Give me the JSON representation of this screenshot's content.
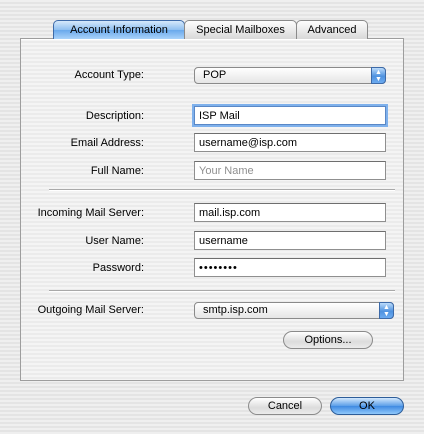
{
  "tabs": [
    {
      "label": "Account Information",
      "active": true
    },
    {
      "label": "Special Mailboxes",
      "active": false
    },
    {
      "label": "Advanced",
      "active": false
    }
  ],
  "form": {
    "account_type": {
      "label": "Account Type:",
      "value": "POP"
    },
    "description": {
      "label": "Description:",
      "value": "ISP Mail"
    },
    "email": {
      "label": "Email Address:",
      "value": "username@isp.com"
    },
    "full_name": {
      "label": "Full Name:",
      "value": "",
      "placeholder": "Your Name"
    },
    "incoming": {
      "label": "Incoming Mail Server:",
      "value": "mail.isp.com"
    },
    "user_name": {
      "label": "User Name:",
      "value": "username"
    },
    "password": {
      "label": "Password:",
      "value": "passwor9"
    },
    "outgoing": {
      "label": "Outgoing Mail Server:",
      "value": "smtp.isp.com"
    },
    "options_label": "Options..."
  },
  "buttons": {
    "cancel": "Cancel",
    "ok": "OK"
  },
  "colors": {
    "accent": "#6aa9ec",
    "default_button": "#3f8ae2"
  },
  "icons": {
    "popup_arrows": "up-down-arrows-icon"
  }
}
